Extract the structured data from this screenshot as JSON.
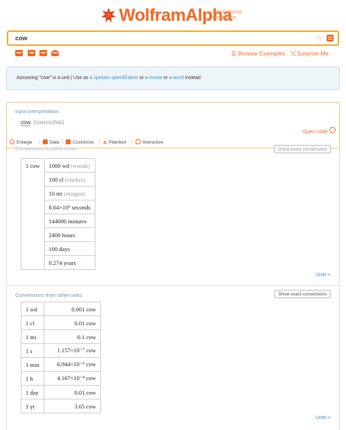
{
  "brand": {
    "name": "WolframAlpha",
    "tagline_1": "computational",
    "tagline_2": "intelligence."
  },
  "search": {
    "value": "cow"
  },
  "nav": {
    "browse_label": "Browse Examples",
    "surprise_label": "Surprise Me"
  },
  "assumption": {
    "prefix": "Assuming \"cow\" is a unit | Use as ",
    "opt1": "a species specification",
    "or1": " or ",
    "opt2": "a movie",
    "or2": " or ",
    "opt3": "a word",
    "suffix": " instead"
  },
  "input_pod": {
    "label": "Input interpretation:",
    "main": "cow",
    "secondary": "(cowznofski)",
    "open_code": "Open code"
  },
  "toolbar": {
    "enlarge": "Enlarge",
    "data": "Data",
    "customize": "Customize",
    "plaintext": "Plaintext",
    "interactive": "Interactive"
  },
  "to_units": {
    "title": "Conversions to other units:",
    "exact_button": "Show exact conversions",
    "row_label": "1 cow",
    "rows": [
      {
        "main": "1000 wd",
        "paren": "(woods)"
      },
      {
        "main": "100 cl",
        "paren": "(clarkes)"
      },
      {
        "main": "10 mi",
        "paren": "(mingos)"
      },
      {
        "main": "8.64×10⁶ seconds",
        "paren": ""
      },
      {
        "main": "144000 minutes",
        "paren": ""
      },
      {
        "main": "2400 hours",
        "paren": ""
      },
      {
        "main": "100 days",
        "paren": ""
      },
      {
        "main": "0.274 years",
        "paren": ""
      }
    ],
    "units_link": "Units »"
  },
  "from_units": {
    "title": "Conversions from other units:",
    "exact_button": "Show exact conversions",
    "rows": [
      {
        "unit": "1 wd",
        "value": "0.001 cow"
      },
      {
        "unit": "1 cl",
        "value": "0.01 cow"
      },
      {
        "unit": "1 mi",
        "value": "0.1 cow"
      },
      {
        "unit": "1 s",
        "value": "1.157×10⁻⁷ cow"
      },
      {
        "unit": "1 min",
        "value": "6.944×10⁻⁶ cow"
      },
      {
        "unit": "1 h",
        "value": "4.167×10⁻⁴ cow"
      },
      {
        "unit": "1 day",
        "value": "0.01 cow"
      },
      {
        "unit": "1 yr",
        "value": "3.65 cow"
      }
    ],
    "units_link": "Units »"
  },
  "colors": {
    "brand_orange": "#f26722",
    "highlight_border": "#f6a623",
    "link_blue": "#3a8fc7",
    "label_blue": "#6e8fa8"
  }
}
